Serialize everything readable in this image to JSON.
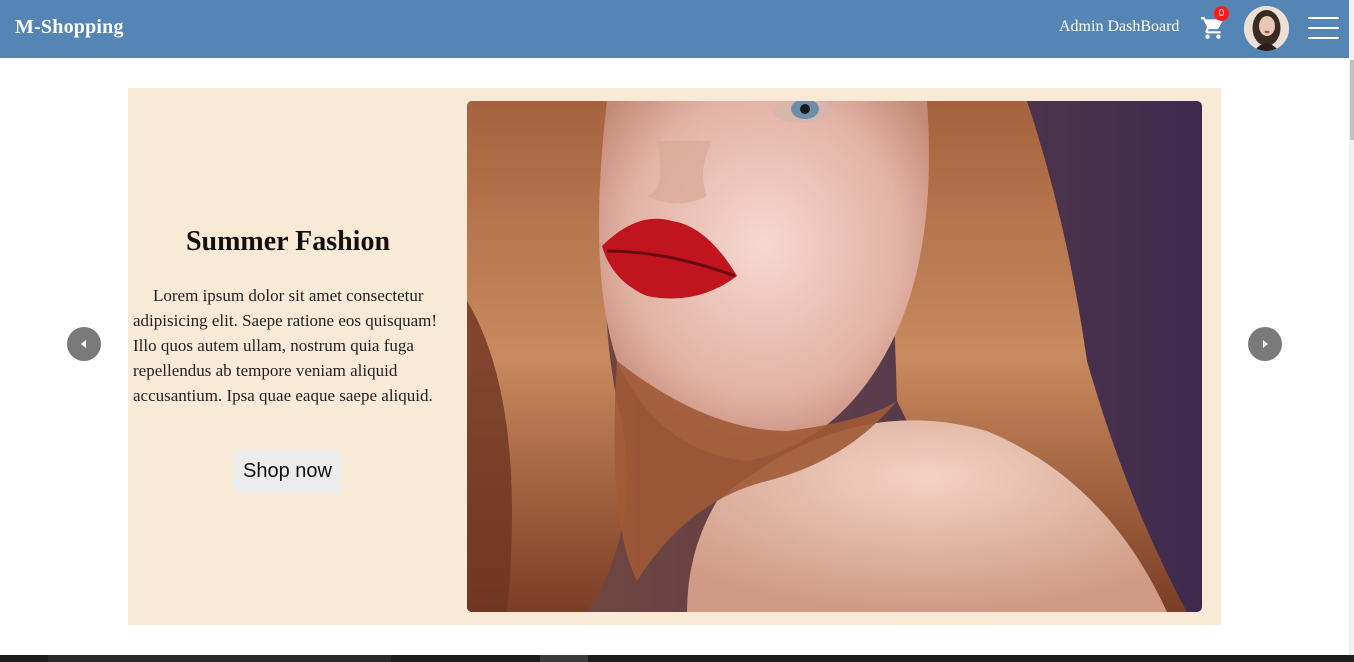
{
  "header": {
    "brand": "M-Shopping",
    "admin_link": "Admin DashBoard",
    "cart_count": "0",
    "cart_icon": "cart-icon",
    "menu_icon": "hamburger-icon",
    "background_color": "#5585b5",
    "badge_color": "#ff1a1a"
  },
  "slide": {
    "title": "Summer Fashion",
    "description": "Lorem ipsum dolor sit amet consectetur adipisicing elit. Saepe ratione eos quisquam! Illo quos autem ullam, nostrum quia fuga repellendus ab tempore veniam aliquid accusantium. Ipsa quae eaque saepe aliquid.",
    "cta_label": "Shop now",
    "background_color": "#f9ead7",
    "image_subject": "model-portrait-red-lips"
  },
  "carousel": {
    "prev_icon": "chevron-left-icon",
    "next_icon": "chevron-right-icon"
  }
}
